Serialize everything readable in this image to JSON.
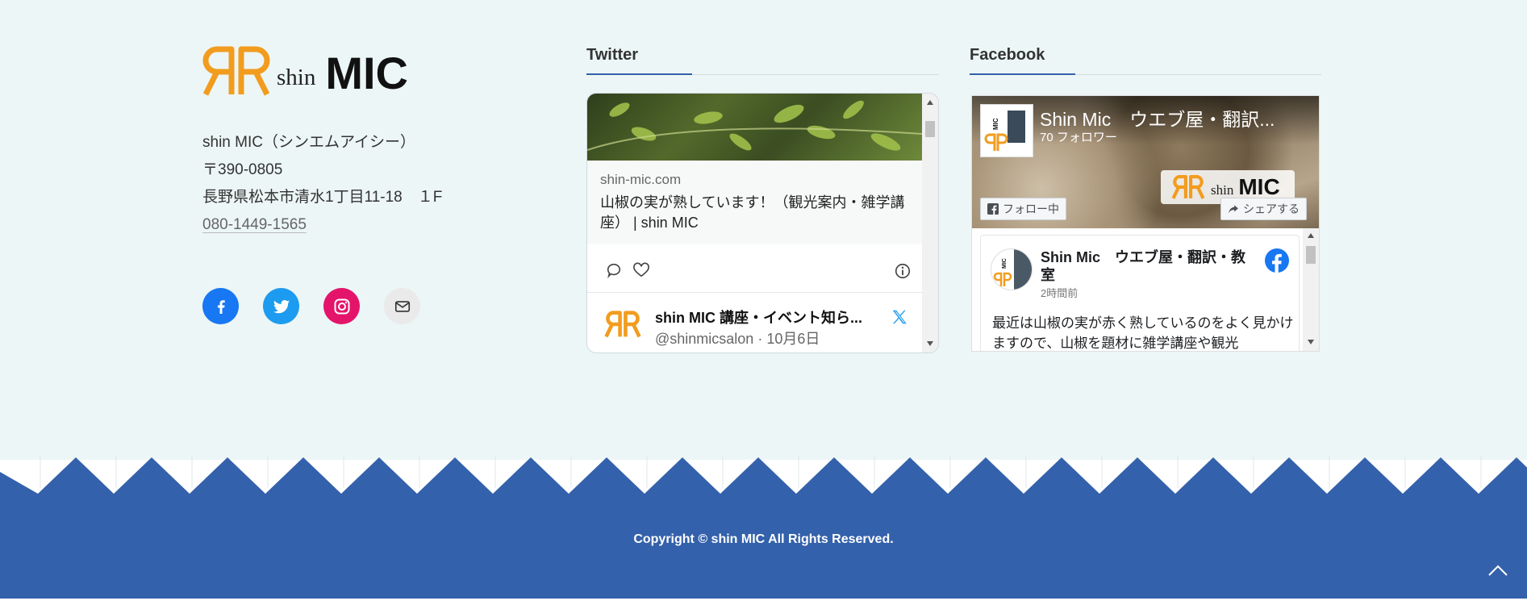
{
  "brand": {
    "logo_shin": "shin",
    "logo_mic": "MIC",
    "logo_color": "#f29c1f"
  },
  "contact": {
    "name": "shin MIC（シンエムアイシー）",
    "postal": "〒390-0805",
    "address": "長野県松本市清水1丁目11-18　１F",
    "phone": "080-1449-1565"
  },
  "social": [
    {
      "icon": "facebook-icon",
      "color": "#1877f2"
    },
    {
      "icon": "twitter-icon",
      "color": "#1d9bf0"
    },
    {
      "icon": "instagram-icon",
      "color": "#e4146b"
    },
    {
      "icon": "mail-icon",
      "color": "#eaeaea"
    }
  ],
  "twitter": {
    "heading": "Twitter",
    "card_domain": "shin-mic.com",
    "card_text": "山椒の実が熟しています！（観光案内・雑学講座） | shin MIC",
    "user_name": "shin MIC 講座・イベント知ら...",
    "user_handle": "@shinmicsalon · 10月6日"
  },
  "facebook": {
    "heading": "Facebook",
    "page_name": "Shin Mic　ウエブ屋・翻訳...",
    "followers": "70 フォロワー",
    "cover_shin": "shin",
    "cover_mic": "MIC",
    "follow_btn": "フォロー中",
    "share_btn": "シェアする",
    "post_title": "Shin Mic　ウエブ屋・翻訳・教室",
    "post_time": "2時間前",
    "post_text": "最近は山椒の実が赤く熟しているのをよく見かけますので、山椒を題材に雑学講座や観光"
  },
  "footer": {
    "copyright": "Copyright © shin MIC All Rights Reserved.",
    "bg_color": "#3461ab"
  }
}
